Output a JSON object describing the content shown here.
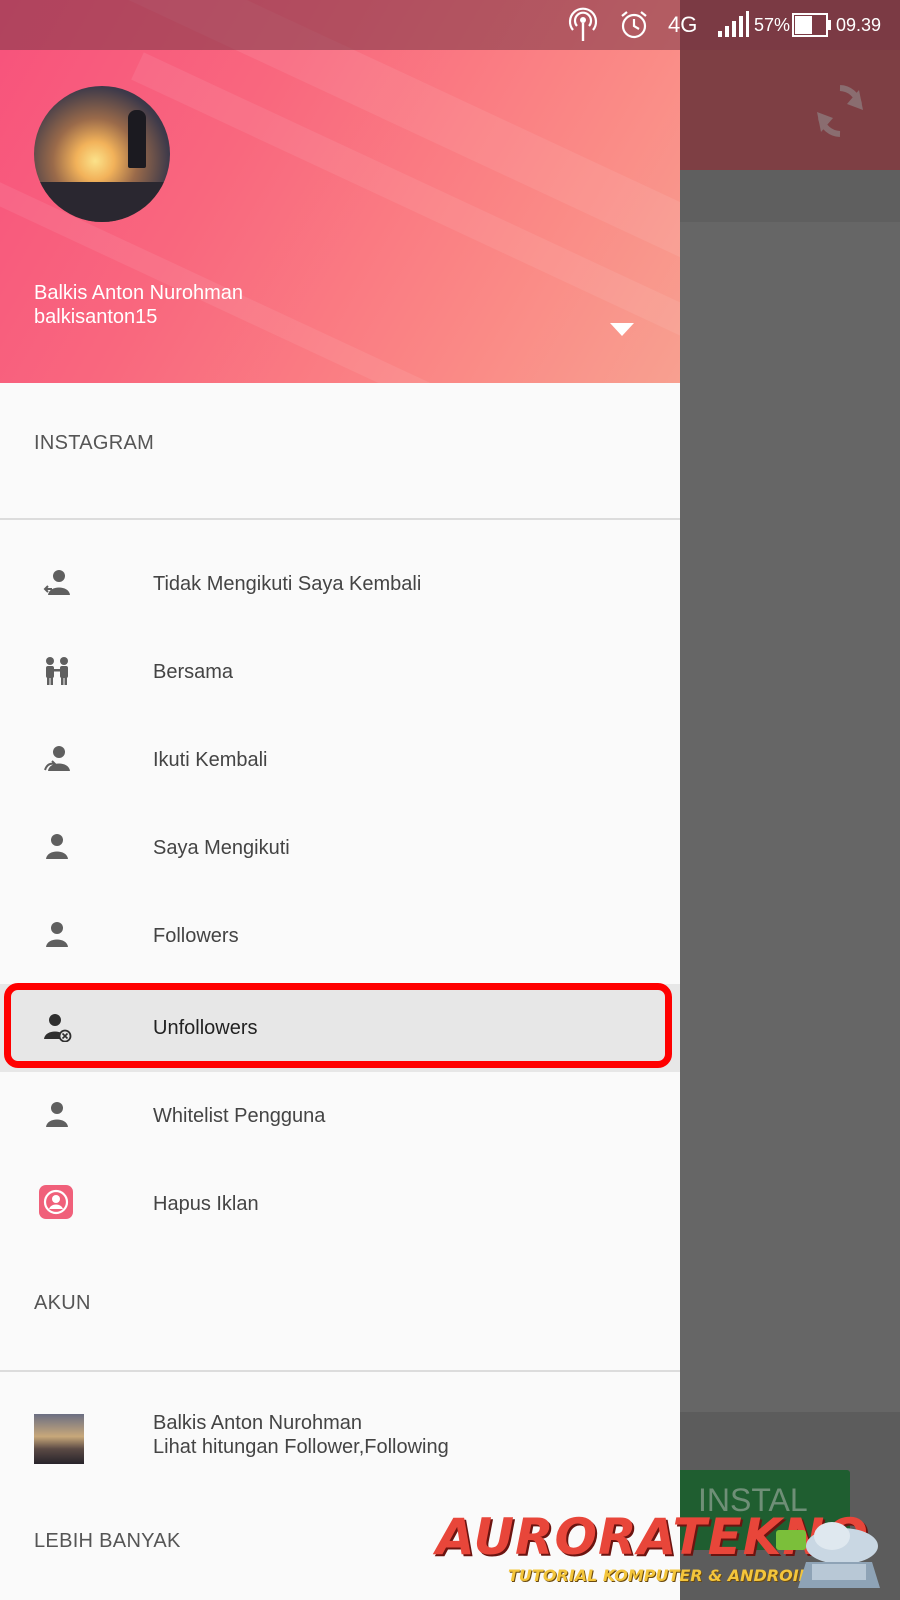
{
  "status_bar": {
    "network": "4G",
    "battery": "57%",
    "time": "09.39"
  },
  "background_app": {
    "install_button": "INSTAL"
  },
  "drawer": {
    "header": {
      "user_name": "Balkis Anton Nurohman",
      "username": "balkisanton15"
    },
    "sections": {
      "instagram": "INSTAGRAM",
      "akun": "AKUN",
      "lebih_banyak": "LEBIH BANYAK"
    },
    "menu_items": [
      {
        "label": "Tidak Mengikuti Saya Kembali",
        "icon": "user-back-icon"
      },
      {
        "label": "Bersama",
        "icon": "two-users-icon"
      },
      {
        "label": "Ikuti Kembali",
        "icon": "user-follow-back-icon"
      },
      {
        "label": "Saya Mengikuti",
        "icon": "user-icon"
      },
      {
        "label": "Followers",
        "icon": "user-icon"
      },
      {
        "label": "Unfollowers",
        "icon": "user-remove-icon",
        "selected": true
      },
      {
        "label": "Whitelist Pengguna",
        "icon": "user-icon"
      },
      {
        "label": "Hapus Iklan",
        "icon": "profile-badge-icon"
      }
    ],
    "account": {
      "name": "Balkis Anton Nurohman",
      "subtitle": "Lihat hitungan Follower,Following"
    }
  },
  "watermark": {
    "title": "AURORATEKNO",
    "subtitle": "TUTORIAL KOMPUTER & ANDROID"
  },
  "colors": {
    "header_gradient_start": "#f7527c",
    "header_gradient_end": "#f8a090",
    "highlight": "#ff0000",
    "icon_gray": "#5f5f5f",
    "hapus_iklan_icon": "#f0607a"
  }
}
